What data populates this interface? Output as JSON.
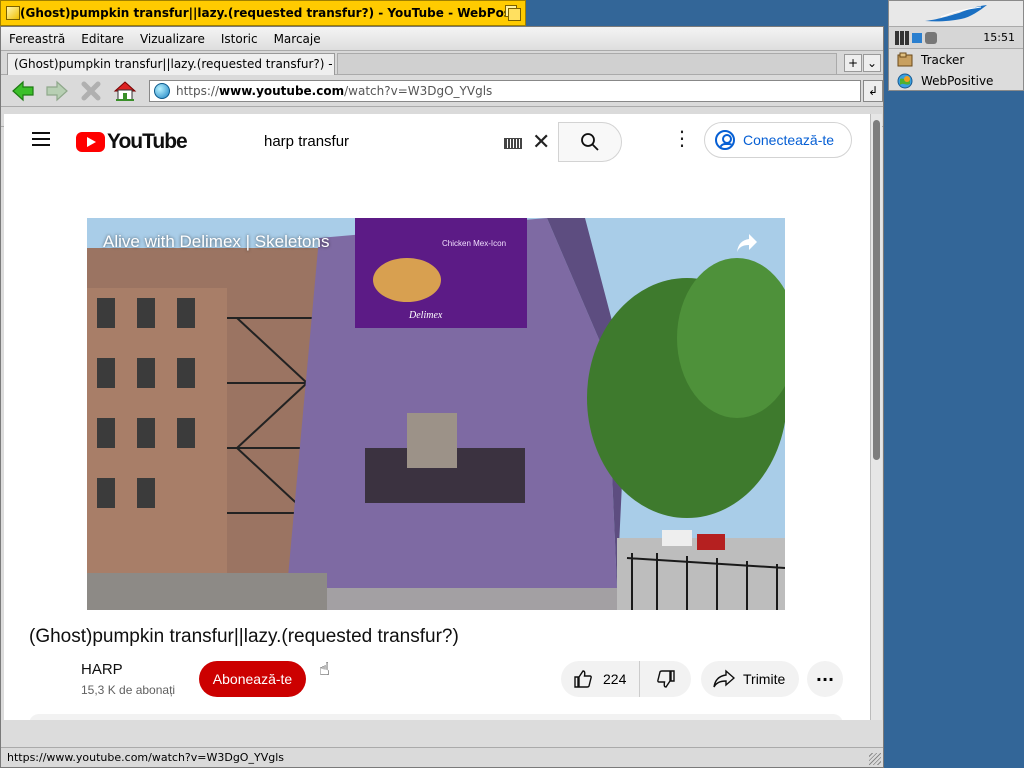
{
  "window": {
    "title": "(Ghost)pumpkin transfur||lazy.(requested transfur?) - YouTube - WebPositive"
  },
  "menu": [
    "Fereastră",
    "Editare",
    "Vizualizare",
    "Istoric",
    "Marcaje"
  ],
  "tab": {
    "label": "(Ghost)pumpkin transfur||lazy.(requested transfur?) - Yo...",
    "new_tab": "+",
    "list": "⌄"
  },
  "url": {
    "scheme": "https://",
    "host": "www.youtube.com",
    "path": "/watch?v=W3DgO_YVgls"
  },
  "bookmarks": {
    "more": "..."
  },
  "status": {
    "text": "https://www.youtube.com/watch?v=W3DgO_YVgls"
  },
  "youtube": {
    "logo_text": "YouTube",
    "search_query": "harp transfur",
    "sign_in": "Conectează-te",
    "player_title": "Alive with Delimex | Skeletons",
    "video_title": "(Ghost)pumpkin transfur||lazy.(requested transfur?)",
    "channel": "HARP",
    "subscribers": "15,3 K de abonați",
    "subscribe": "Abonează-te",
    "likes": "224",
    "share": "Trimite",
    "ad": {
      "banner_line1": "Chicken Mex-Icon",
      "banner_brand": "Delimex"
    }
  },
  "deskbar": {
    "clock": "15:51",
    "apps": [
      "Tracker",
      "WebPositive"
    ]
  },
  "colors": {
    "title_tab": "#ffcb00",
    "desktop": "#336698",
    "yt_red": "#ff0000",
    "subscribe": "#cc0000",
    "link_blue": "#065fd4"
  }
}
